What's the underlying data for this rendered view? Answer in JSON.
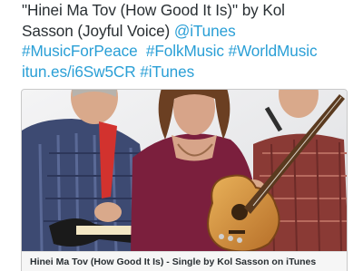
{
  "tweet": {
    "line1": "\"Hinei Ma Tov (How Good It Is)\" by Kol",
    "line2_text": "Sasson (Joyful Voice) ",
    "mention_itunes": "@iTunes",
    "hashtag_music_for_peace": "#MusicForPeace",
    "hashtag_folk_music": "#FolkMusic",
    "hashtag_world_music": "#WorldMusic",
    "short_link": "itun.es/i6Sw5CR",
    "hashtag_itunes": "#iTunes"
  },
  "card": {
    "caption": "Hinei Ma Tov (How Good It Is) - Single by Kol Sasson on iTunes",
    "image_alt": "three musicians with guitars"
  },
  "colors": {
    "text": "#292f33",
    "link": "#2a9fd6"
  }
}
